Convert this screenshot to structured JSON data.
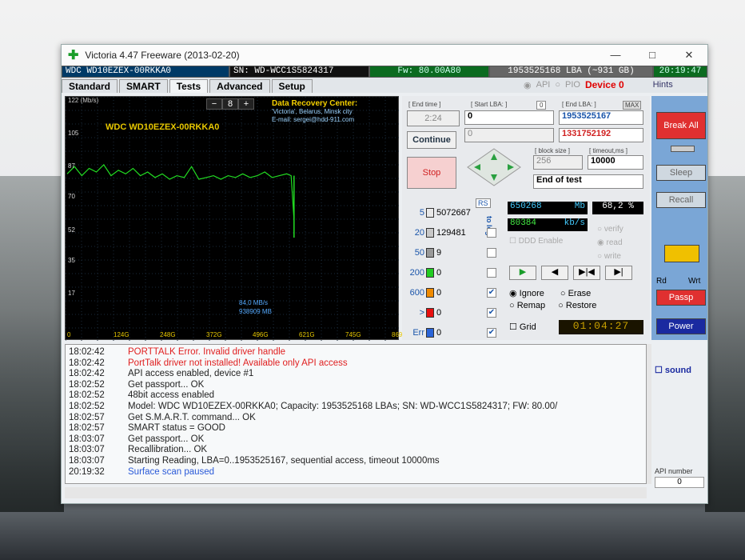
{
  "title": "Victoria 4.47  Freeware (2013-02-20)",
  "window_controls": {
    "min": "—",
    "max": "□",
    "close": "✕"
  },
  "infobar": {
    "model": "WDC WD10EZEX-00RKKA0",
    "sn": "SN: WD-WCC1S5824317",
    "fw": "Fw: 80.00A80",
    "lba": "1953525168 LBA (~931 GB)",
    "clock": "20:19:47"
  },
  "tabs": [
    "Standard",
    "SMART",
    "Tests",
    "Advanced",
    "Setup"
  ],
  "active_tab": "Tests",
  "tab_right": {
    "api": "API",
    "pio": "PIO",
    "device": "Device 0",
    "hints": "Hints"
  },
  "graph": {
    "unit": "122 (Mb/s)",
    "model": "WDC WD10EZEX-00RKKA0",
    "spin_minus": "−",
    "spin_value": "8",
    "spin_plus": "+",
    "drc_title": "Data Recovery Center:",
    "drc_line2": "'Victoria', Belarus, Minsk city",
    "drc_line3": "E-mail: sergei@hdd-911.com",
    "speed": "84,0 MB/s",
    "read_mb": "938909 MB",
    "yticks": [
      "105",
      "87",
      "70",
      "52",
      "35",
      "17"
    ],
    "xticks": [
      "0",
      "124G",
      "248G",
      "372G",
      "496G",
      "621G",
      "745G",
      "869G"
    ]
  },
  "controls": {
    "end_time_lbl": "[ End time ]",
    "start_lba_lbl": "[ Start LBA: ]",
    "start_lba_small": "0",
    "end_lba_lbl": "[ End LBA: ]",
    "max": "MAX",
    "time": "2:24",
    "start_lba": "0",
    "end_lba": "1953525167",
    "current_lba": "1331752192",
    "continue": "Continue",
    "stop": "Stop",
    "block_size_lbl": "[ block size ]",
    "timeout_lbl": "[ timeout,ms ]",
    "block_size": "256",
    "timeout": "10000",
    "end_action": "End of test",
    "rs": "RS",
    "to_log": "to log:",
    "hist": [
      {
        "label": "5",
        "count": "5072667",
        "color": "#e8e8e8"
      },
      {
        "label": "20",
        "count": "129481",
        "color": "#c8c8c8"
      },
      {
        "label": "50",
        "count": "9",
        "color": "#999999"
      },
      {
        "label": "200",
        "count": "0",
        "color": "#22cc22"
      },
      {
        "label": "600",
        "count": "0",
        "color": "#f08a00"
      },
      {
        "label": ">",
        "count": "0",
        "color": "#e81010"
      },
      {
        "label": "Err",
        "count": "0",
        "color": "#2a64d8"
      }
    ],
    "mb_done": "650268",
    "mb_unit": "Mb",
    "percent": "68,2 %",
    "kbs": "80384",
    "kbs_unit": "kb/s",
    "ddd_enable": "DDD Enable",
    "verify": "verify",
    "read": "read",
    "write": "write",
    "ignore": "Ignore",
    "erase": "Erase",
    "remap": "Remap",
    "restore": "Restore",
    "grid": "Grid",
    "timer": "01:04:27"
  },
  "right_panel": {
    "break_all": "Break All",
    "sleep": "Sleep",
    "recall": "Recall",
    "rd": "Rd",
    "wrt": "Wrt",
    "passp": "Passp",
    "power": "Power",
    "sound": "sound",
    "api_number": "API number",
    "api_value": "0"
  },
  "log": [
    {
      "time": "18:02:42",
      "msg": "PORTTALK Error. Invalid driver handle",
      "color": "#e02020"
    },
    {
      "time": "18:02:42",
      "msg": "PortTalk driver not installed! Available only API access",
      "color": "#e02020"
    },
    {
      "time": "18:02:42",
      "msg": "API access enabled, device #1",
      "color": "#222222"
    },
    {
      "time": "18:02:52",
      "msg": "Get passport... OK",
      "color": "#222222"
    },
    {
      "time": "18:02:52",
      "msg": "48bit access enabled",
      "color": "#222222"
    },
    {
      "time": "18:02:52",
      "msg": "Model: WDC WD10EZEX-00RKKA0; Capacity: 1953525168 LBAs; SN: WD-WCC1S5824317; FW: 80.00/",
      "color": "#222222"
    },
    {
      "time": "18:02:57",
      "msg": "Get S.M.A.R.T. command... OK",
      "color": "#222222"
    },
    {
      "time": "18:02:57",
      "msg": "SMART status = GOOD",
      "color": "#222222"
    },
    {
      "time": "18:03:07",
      "msg": "Get passport... OK",
      "color": "#222222"
    },
    {
      "time": "18:03:07",
      "msg": "Recallibration... OK",
      "color": "#222222"
    },
    {
      "time": "18:03:07",
      "msg": "Starting Reading, LBA=0..1953525167, sequential access, timeout 10000ms",
      "color": "#222222"
    },
    {
      "time": "20:19:32",
      "msg": "Surface scan paused",
      "color": "#2a5ad8"
    }
  ],
  "chart_data": {
    "type": "line",
    "ylabel": "122 (Mb/s)",
    "ylim": [
      0,
      122
    ],
    "x_ticks": [
      "0",
      "124G",
      "248G",
      "372G",
      "496G",
      "621G",
      "745G",
      "869G"
    ],
    "xlim_gb": [
      0,
      900
    ],
    "series": [
      {
        "color": "#22dd22",
        "x_gb": [
          0,
          20,
          40,
          60,
          80,
          100,
          120,
          140,
          160,
          180,
          200,
          220,
          240,
          260,
          280,
          300,
          320,
          340,
          360,
          380,
          400,
          420,
          440,
          460,
          480,
          500,
          520,
          540,
          560,
          580,
          600,
          612,
          620
        ],
        "y": [
          85,
          89,
          84,
          88,
          86,
          90,
          84,
          87,
          85,
          88,
          84,
          86,
          83,
          85,
          82,
          84,
          83,
          89,
          82,
          83,
          84,
          82,
          84,
          83,
          85,
          83,
          84,
          86,
          83,
          84,
          85,
          84,
          60
        ]
      }
    ]
  }
}
